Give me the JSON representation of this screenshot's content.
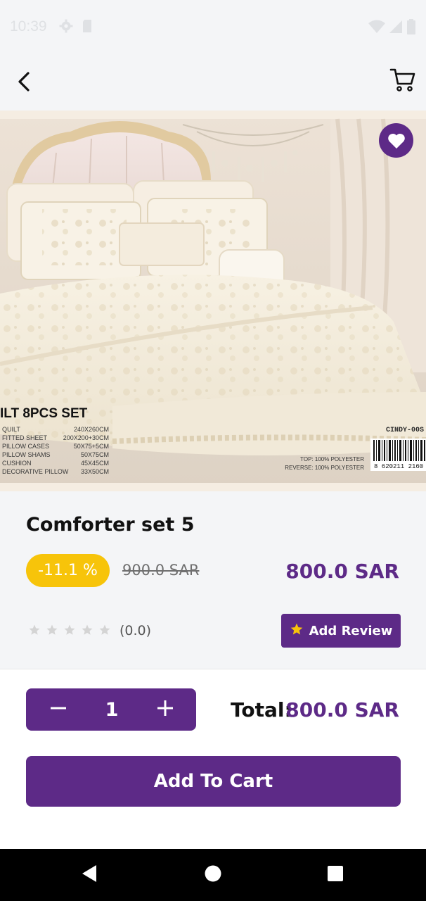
{
  "status_bar": {
    "time": "10:39"
  },
  "product": {
    "name": "Comforter set 5",
    "discount": "-11.1 %",
    "old_price": "900.0 SAR",
    "price": "800.0 SAR",
    "rating_text": "(0.0)",
    "add_review_label": "Add Review"
  },
  "image_text": {
    "title": "ILT  8PCS SET",
    "specs": [
      {
        "item": "QUILT",
        "size": "240X260CM"
      },
      {
        "item": "FITTED SHEET",
        "size": "200X200+30CM"
      },
      {
        "item": "PILLOW CASES",
        "size": "50X75+5CM"
      },
      {
        "item": "PILLOW SHAMS",
        "size": "50X75CM"
      },
      {
        "item": "CUSHION",
        "size": "45X45CM"
      },
      {
        "item": "DECORATIVE PILLOW",
        "size": "33X50CM"
      }
    ],
    "material_top": "TOP: 100% POLYESTER",
    "material_reverse": "REVERSE: 100% POLYESTER",
    "model": "CINDY-00S",
    "barcode_number": "8 620211 2160"
  },
  "cart": {
    "quantity": "1",
    "total_label": "Total:",
    "total_value": "800.0 SAR",
    "add_to_cart_label": "Add To Cart"
  },
  "colors": {
    "primary": "#5d2a87",
    "badge": "#f7c40a",
    "star_inactive": "#d4d4d4",
    "star_active": "#f7c40a"
  }
}
